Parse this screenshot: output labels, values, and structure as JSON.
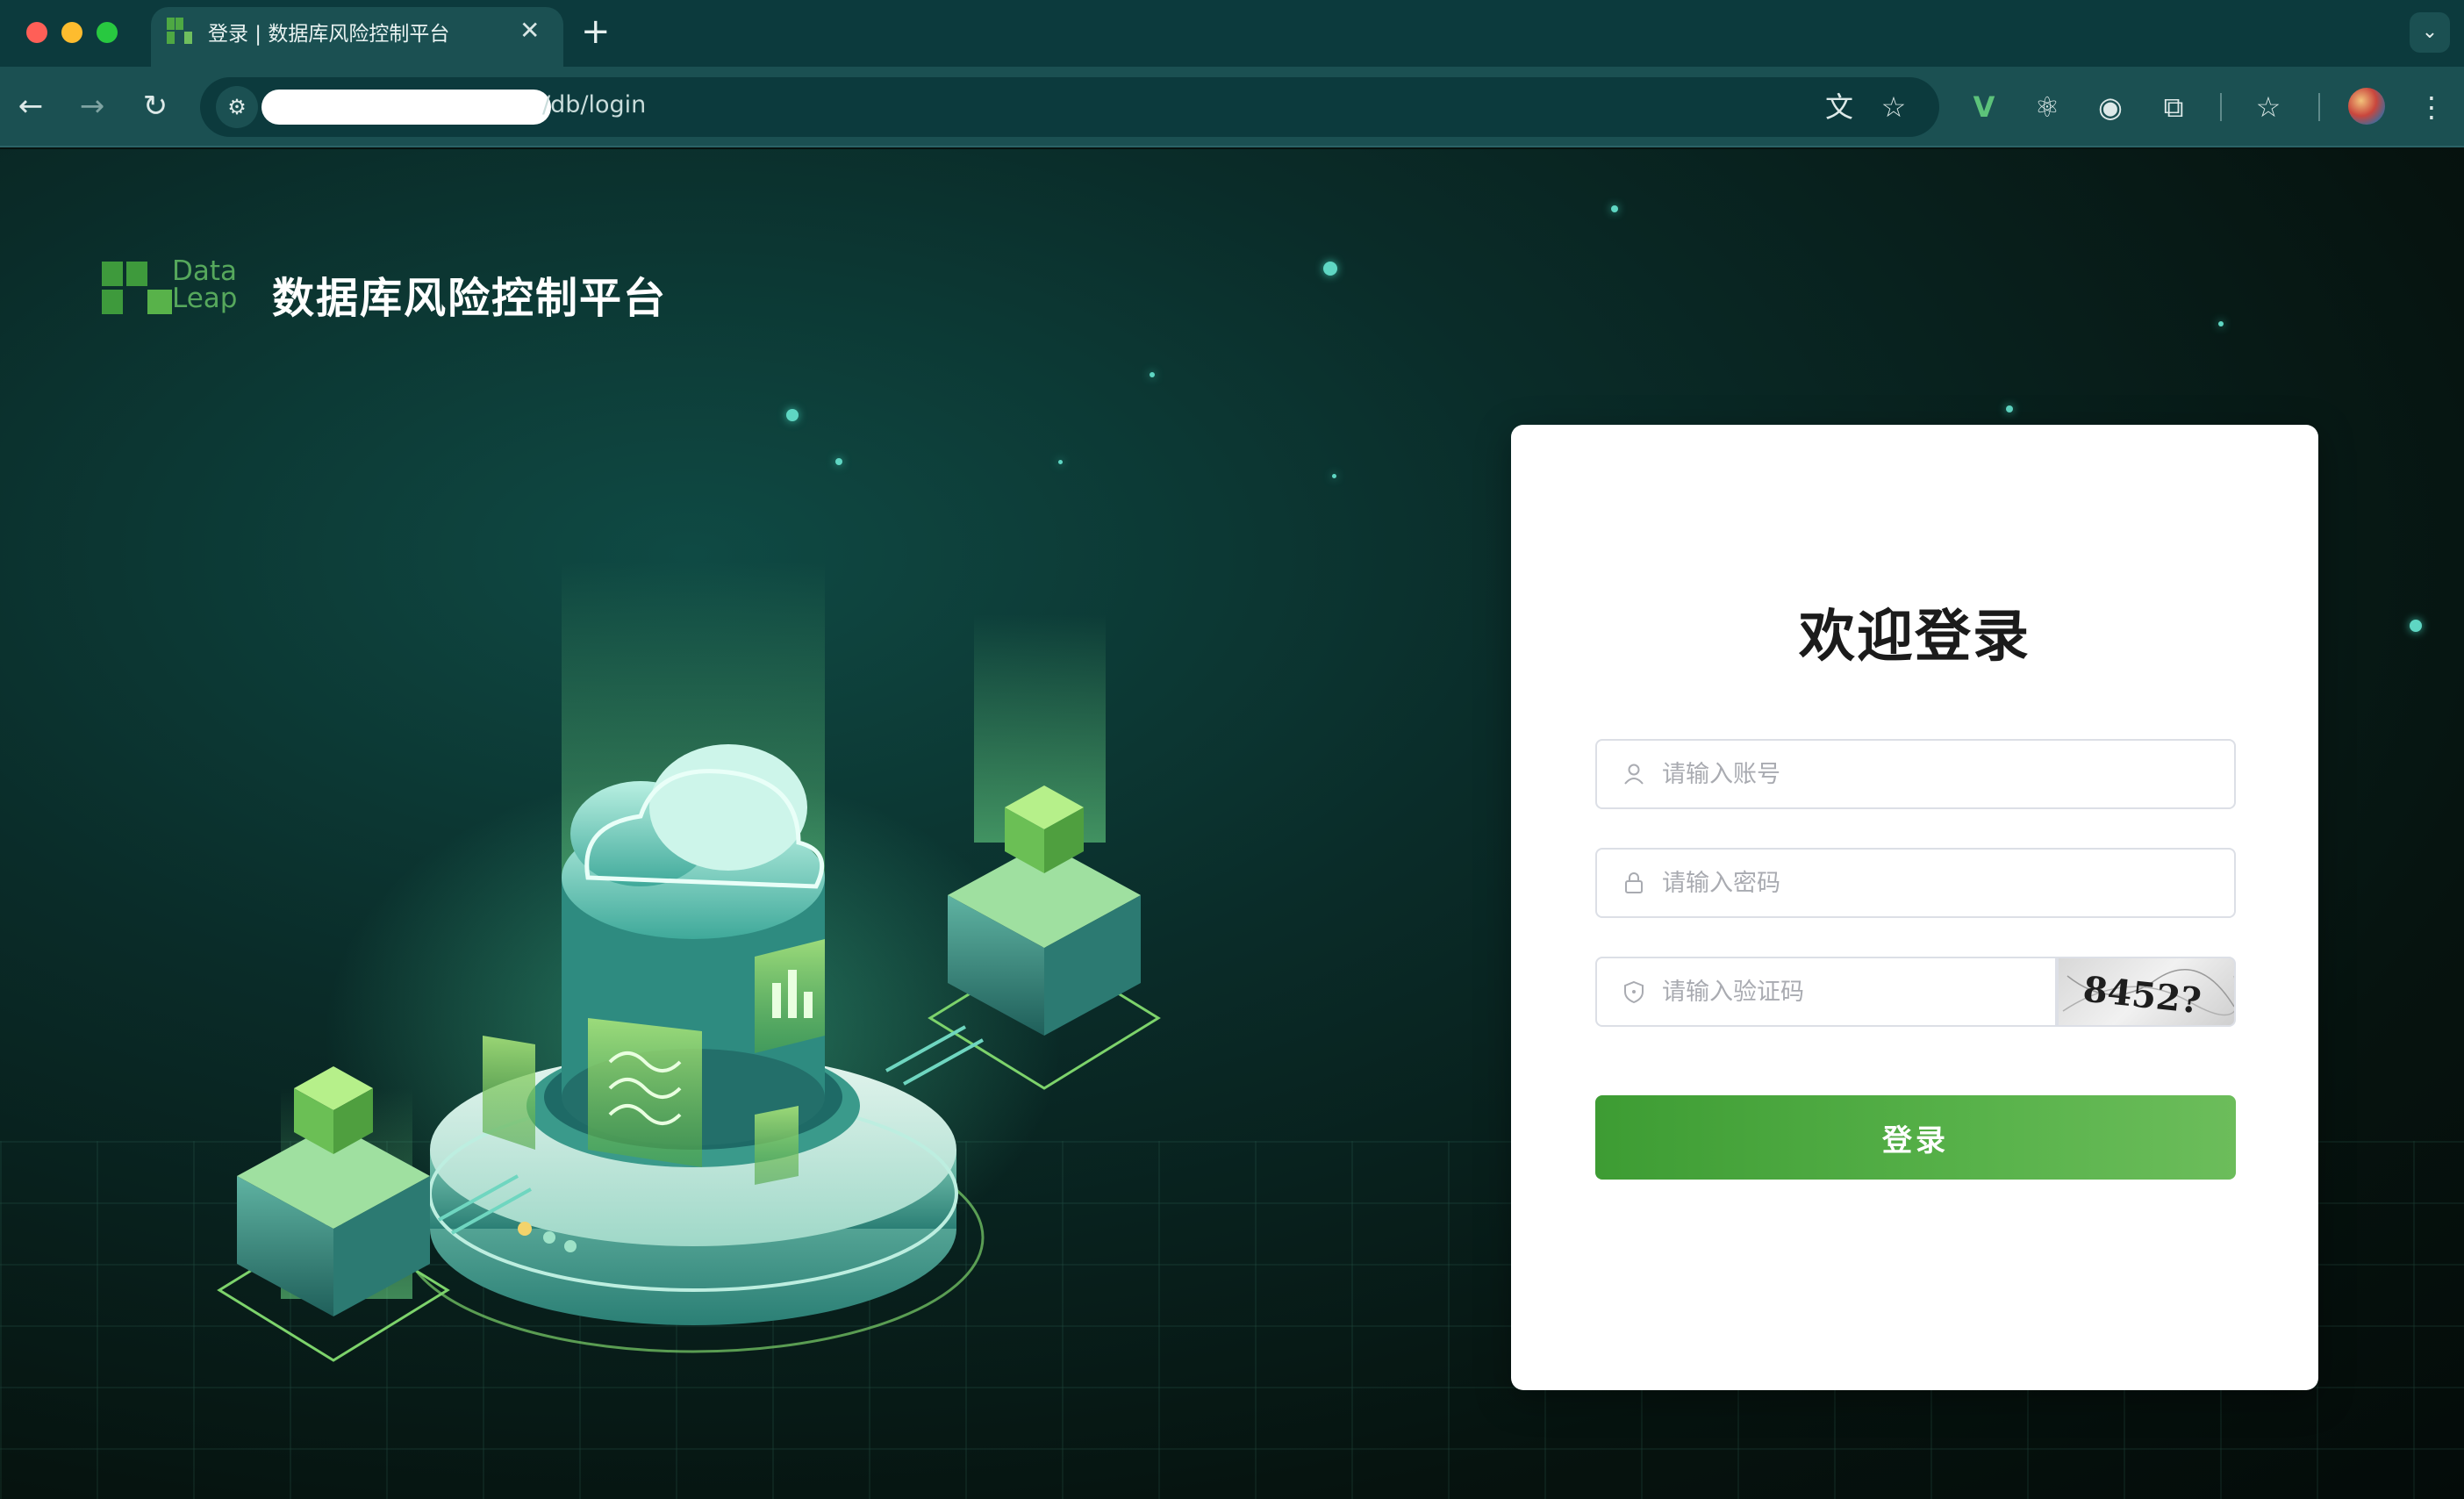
{
  "browser": {
    "tab": {
      "title": "登录 | 数据库风险控制平台",
      "close_label": "✕"
    },
    "new_tab_label": "+",
    "tab_menu_label": "⌄",
    "nav": {
      "back": "←",
      "forward": "→",
      "reload": "↻"
    },
    "address": {
      "url_visible": "/db/login"
    },
    "extensions": [
      "translate-icon",
      "bookmark-star-icon",
      "vue-devtools-icon",
      "react-devtools-icon",
      "extension-c-icon",
      "extensions-puzzle-icon",
      "bookmarks-icon",
      "profile-avatar",
      "menu-icon"
    ]
  },
  "brand": {
    "logo_word_line1": "Data",
    "logo_word_line2": "Leap",
    "app_title": "数据库风险控制平台"
  },
  "login": {
    "title": "欢迎登录",
    "username_placeholder": "请输入账号",
    "password_placeholder": "请输入密码",
    "captcha_placeholder": "请输入验证码",
    "captcha_text": "8452?",
    "submit_label": "登录"
  },
  "colors": {
    "accent_green": "#4ea843",
    "chrome_teal": "#0c3a3d",
    "toolbar_teal": "#1b5052"
  }
}
